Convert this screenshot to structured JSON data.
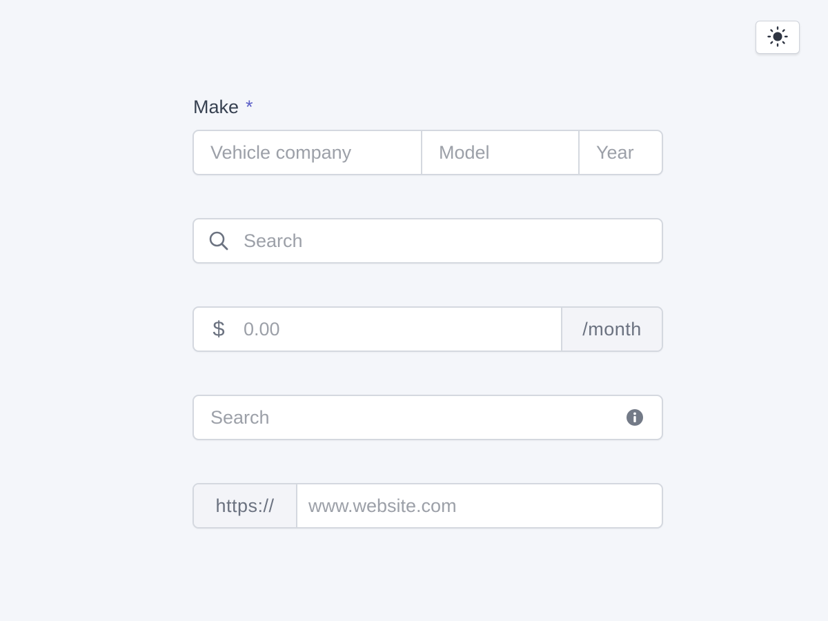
{
  "theme_toggle": {
    "icon": "sun-icon"
  },
  "make": {
    "label": "Make",
    "required_marker": "*",
    "company_placeholder": "Vehicle company",
    "model_placeholder": "Model",
    "year_placeholder": "Year"
  },
  "search_field": {
    "icon": "search-icon",
    "placeholder": "Search"
  },
  "price_field": {
    "currency_symbol": "$",
    "placeholder": "0.00",
    "suffix": "/month"
  },
  "search_info_field": {
    "placeholder": "Search",
    "icon": "info-icon"
  },
  "website_field": {
    "prefix": "https://",
    "placeholder": "www.website.com"
  },
  "colors": {
    "background": "#f4f6fa",
    "required_accent": "#5b5fc7",
    "border": "#d4d8df",
    "addon_background": "#f3f4f8"
  }
}
